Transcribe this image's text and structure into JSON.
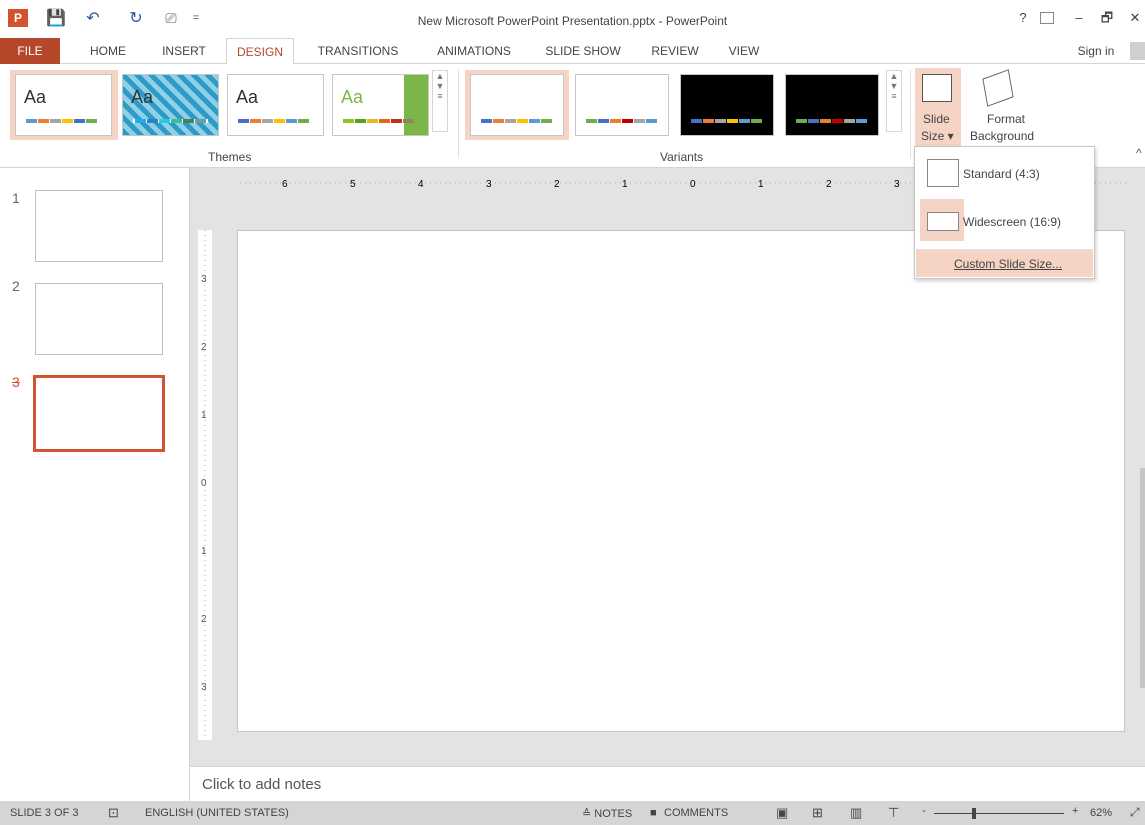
{
  "window": {
    "title": "New Microsoft PowerPoint Presentation.pptx - PowerPoint",
    "help": "?",
    "minimize": "–",
    "restore": "🗗",
    "close": "✕"
  },
  "qat": {
    "app_icon": "P",
    "save_icon": "💾",
    "undo_icon": "↶",
    "redo_icon": "↻",
    "present_icon": "⎚",
    "customize_icon": "="
  },
  "tabs": [
    "FILE",
    "HOME",
    "INSERT",
    "DESIGN",
    "TRANSITIONS",
    "ANIMATIONS",
    "SLIDE SHOW",
    "REVIEW",
    "VIEW"
  ],
  "sign_in": "Sign in",
  "ribbon": {
    "themes_label": "Themes",
    "variants_label": "Variants",
    "theme_text": "Aa",
    "slide_size_label_1": "Slide",
    "slide_size_label_2": "Size ▾",
    "format_bg_label_1": "Format",
    "format_bg_label_2": "Background",
    "collapse_icon": "^"
  },
  "colors": {
    "accent": "#b7472a",
    "selected": "#d35230",
    "highlight": "#f5d4c5"
  },
  "slides": [
    {
      "number": "1"
    },
    {
      "number": "2"
    },
    {
      "number": "3"
    }
  ],
  "rulers": {
    "horizontal": [
      "6",
      "5",
      "4",
      "3",
      "2",
      "1",
      "0",
      "1",
      "2",
      "3"
    ],
    "vertical": [
      "3",
      "2",
      "1",
      "0",
      "1",
      "2",
      "3"
    ]
  },
  "notes_placeholder": "Click to add notes",
  "dropdown": {
    "standard": "Standard (4:3)",
    "widescreen": "Widescreen (16:9)",
    "custom": "Custom Slide Size..."
  },
  "status": {
    "slide_counter": "SLIDE 3 OF 3",
    "language": "ENGLISH (UNITED STATES)",
    "notes": "≙ NOTES",
    "comments": "COMMENTS",
    "zoom": "62%",
    "zoom_minus": "-",
    "zoom_plus": "+"
  }
}
